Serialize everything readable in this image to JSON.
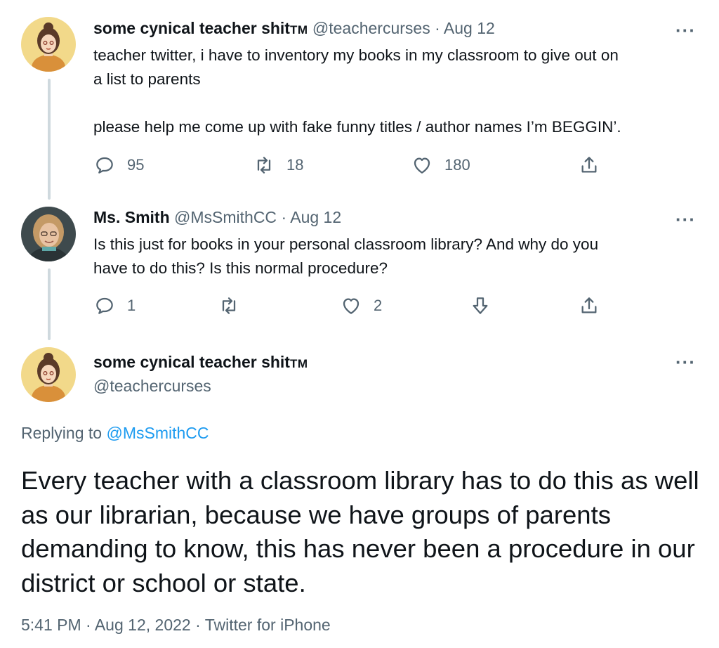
{
  "tweet1": {
    "author_name": "some cynical teacher shit",
    "author_suffix": "TM",
    "handle": "@teachercurses",
    "sep": "·",
    "date": "Aug 12",
    "text": "teacher twitter, i have to inventory my books in my classroom to give out on\na list to parents\n\nplease help me come up with fake funny titles / author names I’m BEGGIN’.",
    "replies": "95",
    "retweets": "18",
    "likes": "180"
  },
  "tweet2": {
    "author_name": "Ms. Smith",
    "handle": "@MsSmithCC",
    "sep": "·",
    "date": "Aug 12",
    "text": "Is this just for books in your personal classroom library? And why do you\nhave to do this? Is this normal procedure?",
    "replies": "1",
    "likes": "2"
  },
  "main_tweet": {
    "author_name": "some cynical teacher shit",
    "author_suffix": "TM",
    "handle": "@teachercurses",
    "replying_prefix": "Replying to ",
    "replying_handle": "@MsSmithCC",
    "text": "Every teacher with a classroom library has to do this as well as our librarian, because we have groups of parents demanding to know, this has never been a procedure in our district or school or state.",
    "time": "5:41 PM",
    "date": "Aug 12, 2022",
    "source": "Twitter for iPhone",
    "sep": "·"
  },
  "more_label": "···",
  "icons": [
    "reply-icon",
    "retweet-icon",
    "like-icon",
    "share-icon",
    "downvote-icon",
    "more-icon"
  ],
  "colors": {
    "link": "#1d9bf0",
    "secondary": "#536471",
    "thread_line": "#cfd9de"
  }
}
